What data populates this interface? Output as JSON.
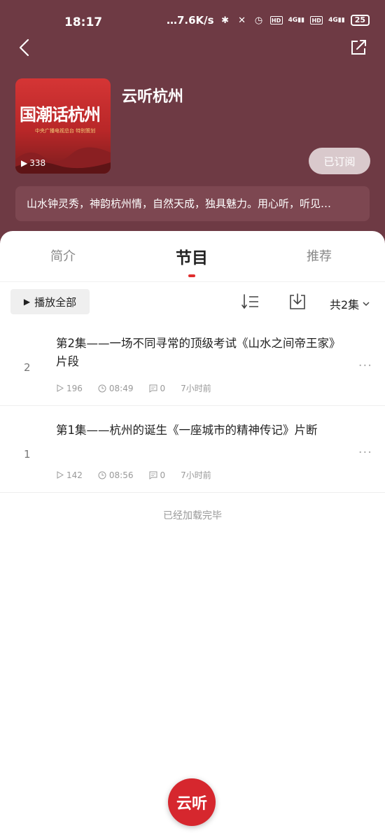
{
  "status_bar": {
    "time": "18:17",
    "network_speed": "…7.6K/s",
    "battery": "25",
    "network_1": "4G",
    "network_2": "4G",
    "hd_1": "HD",
    "hd_2": "HD"
  },
  "album": {
    "title": "云听杭州",
    "cover_title": "国潮话杭州",
    "cover_subtitle": "中央广播电视总台 特别策划",
    "play_count": "338",
    "subscribe_label": "已订阅",
    "description": "山水钟灵秀，神韵杭州情，自然天成，独具魅力。用心听，听见…"
  },
  "tabs": [
    {
      "label": "简介",
      "active": false
    },
    {
      "label": "节目",
      "active": true
    },
    {
      "label": "推荐",
      "active": false
    }
  ],
  "toolbar": {
    "play_all_label": "播放全部",
    "episode_count_label": "共2集"
  },
  "episodes": [
    {
      "index": "2",
      "title": "第2集——一场不同寻常的顶级考试《山水之间帝王家》片段",
      "plays": "196",
      "duration": "08:49",
      "comments": "0",
      "time_ago": "7小时前"
    },
    {
      "index": "1",
      "title": "第1集——杭州的诞生《一座城市的精神传记》片断",
      "plays": "142",
      "duration": "08:56",
      "comments": "0",
      "time_ago": "7小时前"
    }
  ],
  "footer": {
    "load_complete": "已经加载完毕",
    "logo_text": "云听"
  },
  "colors": {
    "hero_background": "#6e3a44",
    "accent_red": "#e02d2d",
    "logo_red": "#d6272e"
  },
  "icons": {
    "back": "chevron-left-icon",
    "share": "share-icon",
    "play": "play-icon",
    "sort": "sort-icon",
    "download": "download-icon",
    "dropdown": "chevron-down-icon",
    "plays": "play-outline-icon",
    "duration": "clock-icon",
    "comments": "comment-icon",
    "more": "more-dots-icon"
  }
}
